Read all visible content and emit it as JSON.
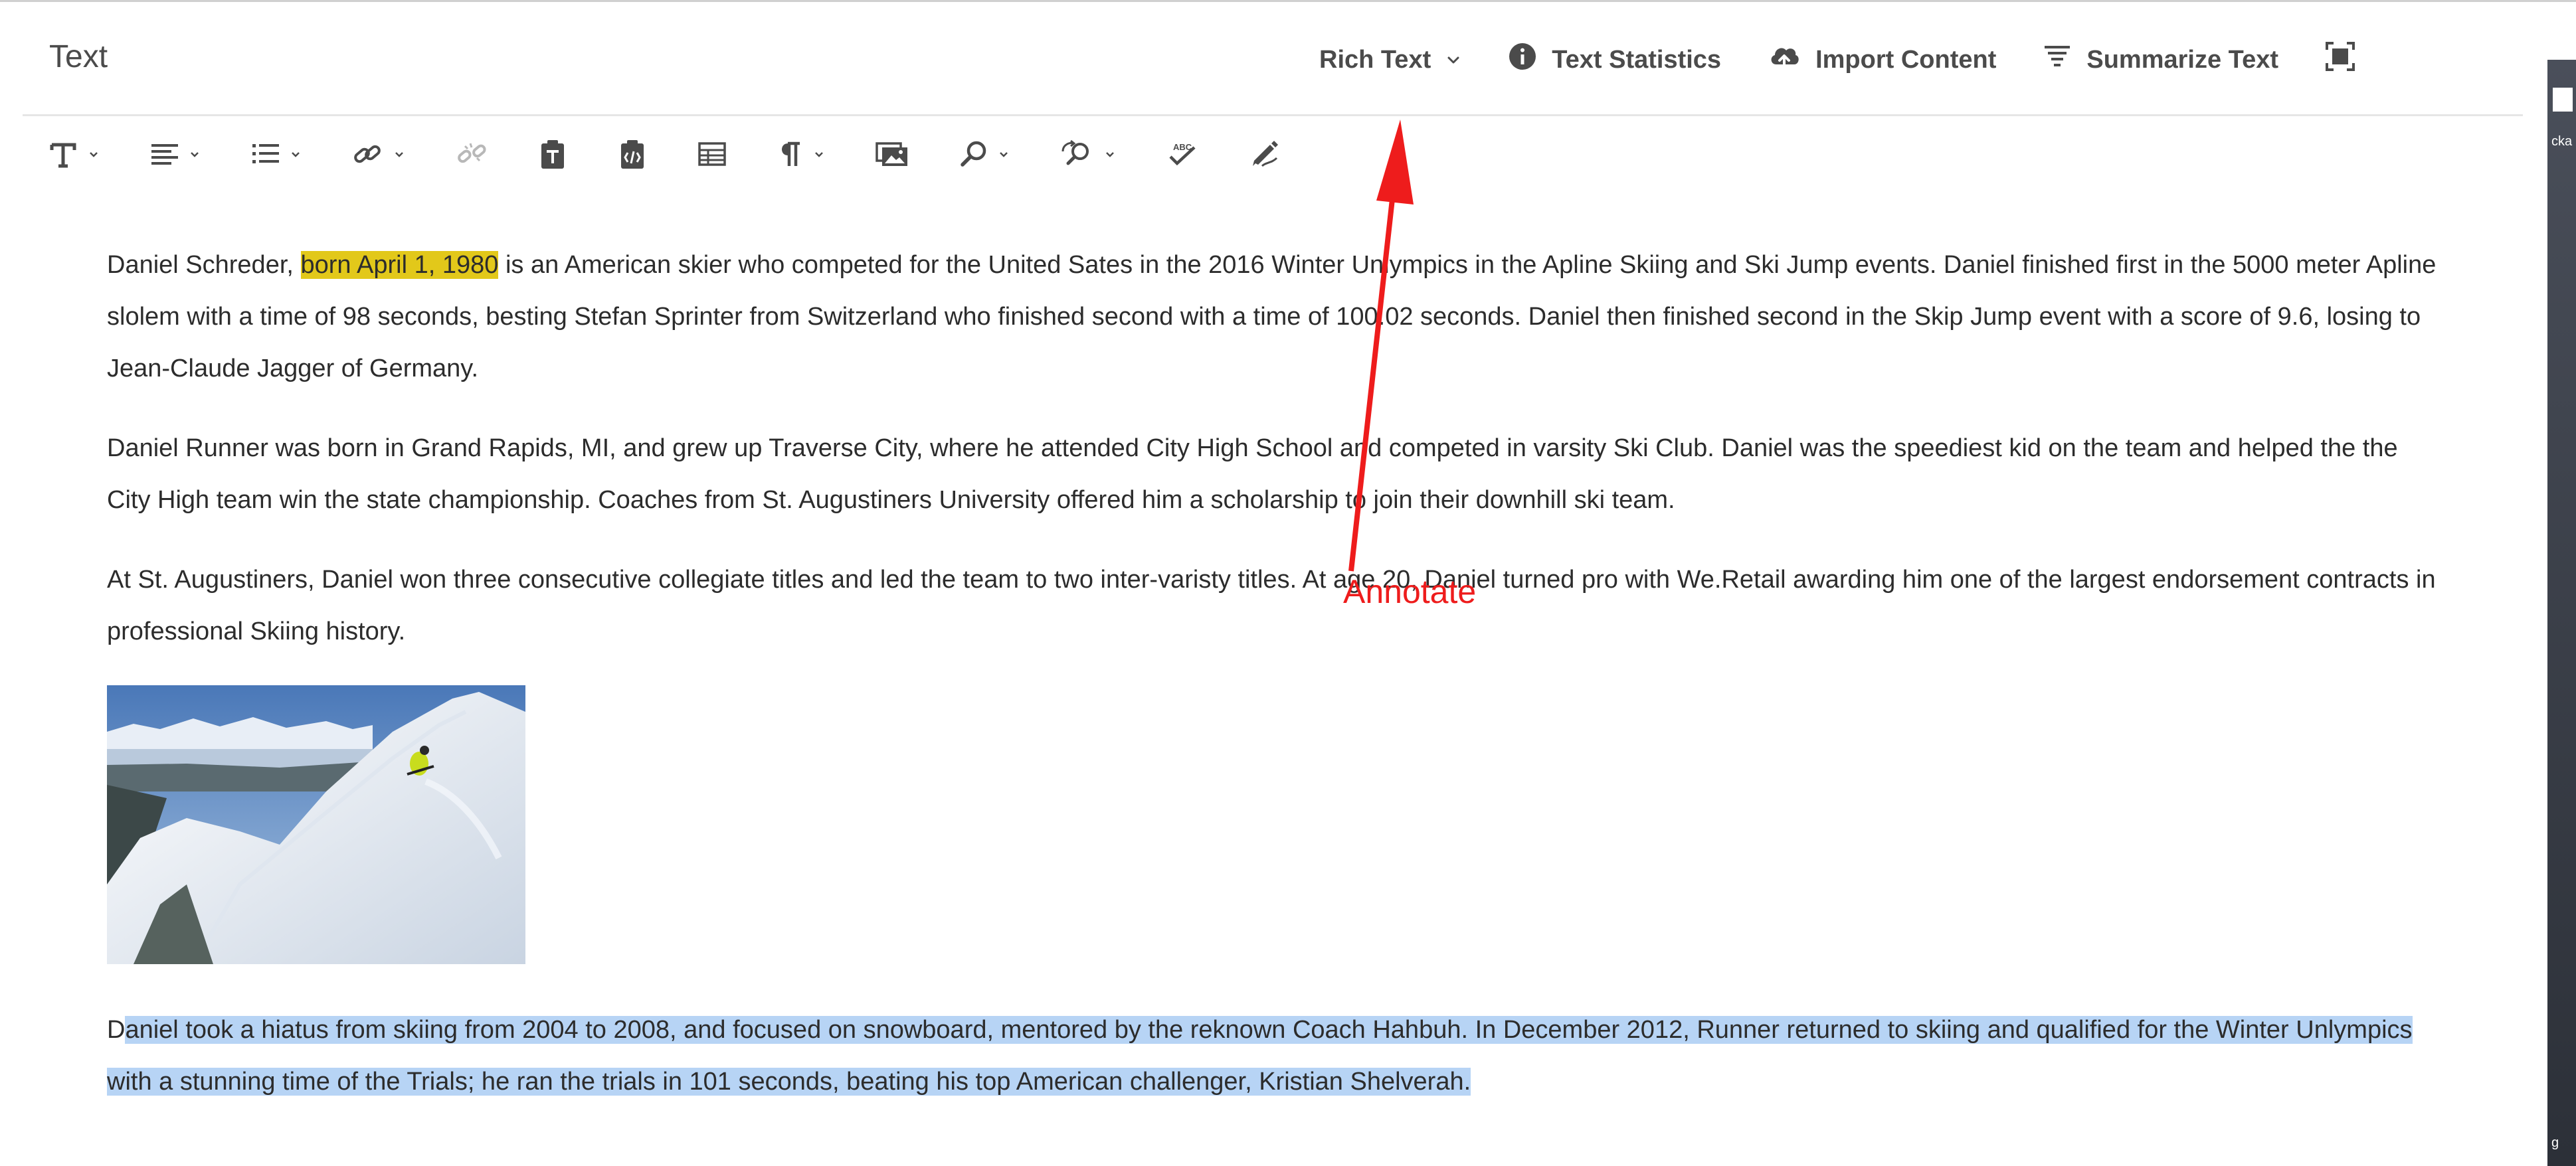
{
  "header": {
    "title": "Text",
    "actions": [
      {
        "label": "Rich Text",
        "icon": "chevron-down-icon"
      },
      {
        "label": "Text Statistics",
        "icon": "info-icon"
      },
      {
        "label": "Import Content",
        "icon": "cloud-upload-icon"
      },
      {
        "label": "Summarize Text",
        "icon": "summarize-icon"
      },
      {
        "label": "",
        "icon": "fullscreen-icon"
      }
    ]
  },
  "toolbar": {
    "buttons": [
      {
        "name": "format-text",
        "icon": "text-format-icon",
        "dropdown": true
      },
      {
        "name": "justify",
        "icon": "align-left-icon",
        "dropdown": true
      },
      {
        "name": "lists",
        "icon": "list-icon",
        "dropdown": true
      },
      {
        "name": "link",
        "icon": "link-icon",
        "dropdown": true
      },
      {
        "name": "unlink",
        "icon": "unlink-icon",
        "dropdown": false
      },
      {
        "name": "paste-as-text",
        "icon": "paste-text-icon",
        "dropdown": false
      },
      {
        "name": "paste-from-word",
        "icon": "paste-word-icon",
        "dropdown": false
      },
      {
        "name": "table",
        "icon": "table-icon",
        "dropdown": false
      },
      {
        "name": "paragraph",
        "icon": "pilcrow-icon",
        "dropdown": true
      },
      {
        "name": "insert-image",
        "icon": "image-icon",
        "dropdown": false
      },
      {
        "name": "find",
        "icon": "search-icon",
        "dropdown": true
      },
      {
        "name": "find-replace",
        "icon": "find-replace-icon",
        "dropdown": true
      },
      {
        "name": "spellcheck",
        "icon": "spellcheck-icon",
        "dropdown": false
      },
      {
        "name": "annotate",
        "icon": "annotate-icon",
        "dropdown": false
      }
    ]
  },
  "content": {
    "p1": {
      "before": "Daniel Schreder, ",
      "highlight": "born April 1, 1980",
      "after": " is an American skier who competed for the United Sates in the 2016 Winter Unlympics in the Apline Skiing and Ski Jump events. Daniel finished first in the 5000 meter Apline slolem with a time of 98 seconds, besting Stefan Sprinter from Switzerland who finished second with a time of 100.02 seconds. Daniel then finished second in the Skip Jump event with a score of 9.6, losing to Jean-Claude Jagger of Germany."
    },
    "p2": "Daniel Runner was born in Grand Rapids, MI, and grew up Traverse City, where he attended City High School and competed in varsity Ski Club. Daniel was the speediest kid on the team and helped the the City High team win the state championship. Coaches from St. Augustiners University offered him a scholarship to join their downhill ski team.",
    "p3": "At St. Augustiners, Daniel won three consecutive collegiate titles and led the team to two inter-varisty titles. At age 20, Daniel turned pro with We.Retail awarding him one of the largest endorsement contracts in professional Skiing history.",
    "p4": {
      "first": "D",
      "selected": "aniel took a hiatus from skiing from 2004 to 2008, and focused on snowboard, mentored by the reknown Coach Hahbuh.  In December 2012, Runner returned to skiing and qualified for the  Winter Unlympics with a stunning time of the Trials; he ran the trials in 101 seconds, beating his top American challenger, Kristian Shelverah."
    }
  },
  "annotation": {
    "label": "Annotate",
    "color": "#ee1c1c"
  },
  "side_strip": {
    "line1": "cka",
    "line2": "g"
  },
  "colors": {
    "highlight": "#e2c81a",
    "selection": "#b7d4f5",
    "annotation": "#ee1c1c",
    "icon": "#4b4b4b"
  }
}
